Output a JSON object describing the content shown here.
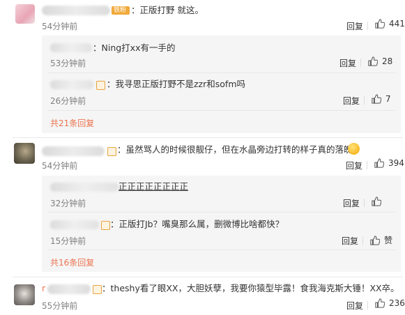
{
  "comments": [
    {
      "text": "：正版打野 就这。",
      "time": "54分钟前",
      "reply_label": "回复",
      "likes": "441",
      "badge_label": "铁粉",
      "replies": [
        {
          "text": "：Ning打xx有一手的",
          "time": "53分钟前",
          "reply_label": "回复",
          "likes": "28"
        },
        {
          "text": "：我寻思正版打野不是zzr和sofm吗",
          "time": "26分钟前",
          "reply_label": "回复",
          "likes": "7"
        }
      ],
      "more_replies": "共21条回复"
    },
    {
      "text": "：虽然骂人的时候很靓仔，但在水晶旁边打转的样子真的落魄。",
      "time": "54分钟前",
      "reply_label": "回复",
      "likes": "394",
      "replies": [
        {
          "text": "正正正正正正正正",
          "time": "32分钟前",
          "reply_label": "回复",
          "likes": ""
        },
        {
          "text": "：正版打Jb？嘴臭那么属，删微博比啥都快？",
          "time": "15分钟前",
          "reply_label": "回复",
          "likes": "赞"
        }
      ],
      "more_replies": "共16条回复"
    },
    {
      "text": "：theshy看了眼XX，大胆妖孽，我要你猿型毕露！食我海克斯大锤！XX卒。",
      "name_prefix": "r",
      "time": "55分钟前",
      "reply_label": "回复",
      "likes": "236"
    }
  ],
  "colors": {
    "link": "#eb7350",
    "muted": "#808080",
    "reply_bg": "#f5f5f5"
  }
}
